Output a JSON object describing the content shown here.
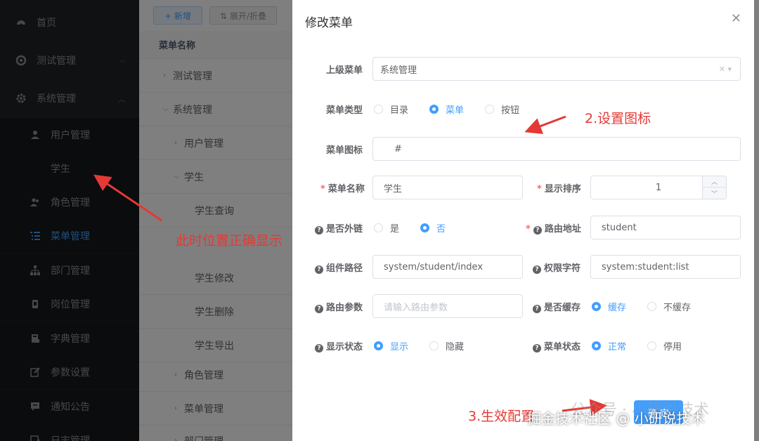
{
  "sidebar": {
    "items": [
      {
        "label": "首页",
        "icon": "dashboard-icon"
      },
      {
        "label": "测试管理",
        "icon": "gear-circle-icon"
      },
      {
        "label": "系统管理",
        "icon": "gear-icon"
      },
      {
        "label": "用户管理",
        "icon": "user-icon"
      },
      {
        "label": "学生"
      },
      {
        "label": "角色管理",
        "icon": "users-icon"
      },
      {
        "label": "菜单管理",
        "icon": "tree-table-icon"
      },
      {
        "label": "部门管理",
        "icon": "org-tree-icon"
      },
      {
        "label": "岗位管理",
        "icon": "post-icon"
      },
      {
        "label": "字典管理",
        "icon": "dict-icon"
      },
      {
        "label": "参数设置",
        "icon": "edit-icon"
      },
      {
        "label": "通知公告",
        "icon": "message-icon"
      },
      {
        "label": "日志管理",
        "icon": "log-icon"
      }
    ]
  },
  "toolbar": {
    "add_label": "+ 新增",
    "expand_label": "⇅ 展开/折叠"
  },
  "table": {
    "header": "菜单名称",
    "rows": [
      "测试管理",
      "系统管理",
      "用户管理",
      "学生",
      "学生查询",
      "学生修改",
      "学生删除",
      "学生导出",
      "角色管理",
      "菜单管理",
      "部门管理"
    ]
  },
  "dialog": {
    "title": "修改菜单",
    "parent_label": "上级菜单",
    "parent_value": "系统管理",
    "type_label": "菜单类型",
    "type_options": [
      "目录",
      "菜单",
      "按钮"
    ],
    "icon_label": "菜单图标",
    "icon_value": "#",
    "name_label": "菜单名称",
    "name_value": "学生",
    "order_label": "显示排序",
    "order_value": "1",
    "external_label": "是否外链",
    "external_options": [
      "是",
      "否"
    ],
    "path_label": "路由地址",
    "path_value": "student",
    "component_label": "组件路径",
    "component_value": "system/student/index",
    "perm_label": "权限字符",
    "perm_value": "system:student:list",
    "query_label": "路由参数",
    "query_placeholder": "请输入路由参数",
    "cache_label": "是否缓存",
    "cache_options": [
      "缓存",
      "不缓存"
    ],
    "visible_label": "显示状态",
    "visible_options": [
      "显示",
      "隐藏"
    ],
    "status_label": "菜单状态",
    "status_options": [
      "正常",
      "停用"
    ],
    "confirm_label": "确 定"
  },
  "annotations": {
    "a1": "此时位置正确显示",
    "a2": "2.设置图标",
    "a3": "3.生效配置"
  },
  "watermark": {
    "bg": "公众号 · 小研说技术",
    "fg": "掘金技术社区 @ 小研说技术"
  },
  "colors": {
    "accent": "#409eff",
    "sidebar_bg": "#1e2226",
    "annotation": "#e53935"
  }
}
